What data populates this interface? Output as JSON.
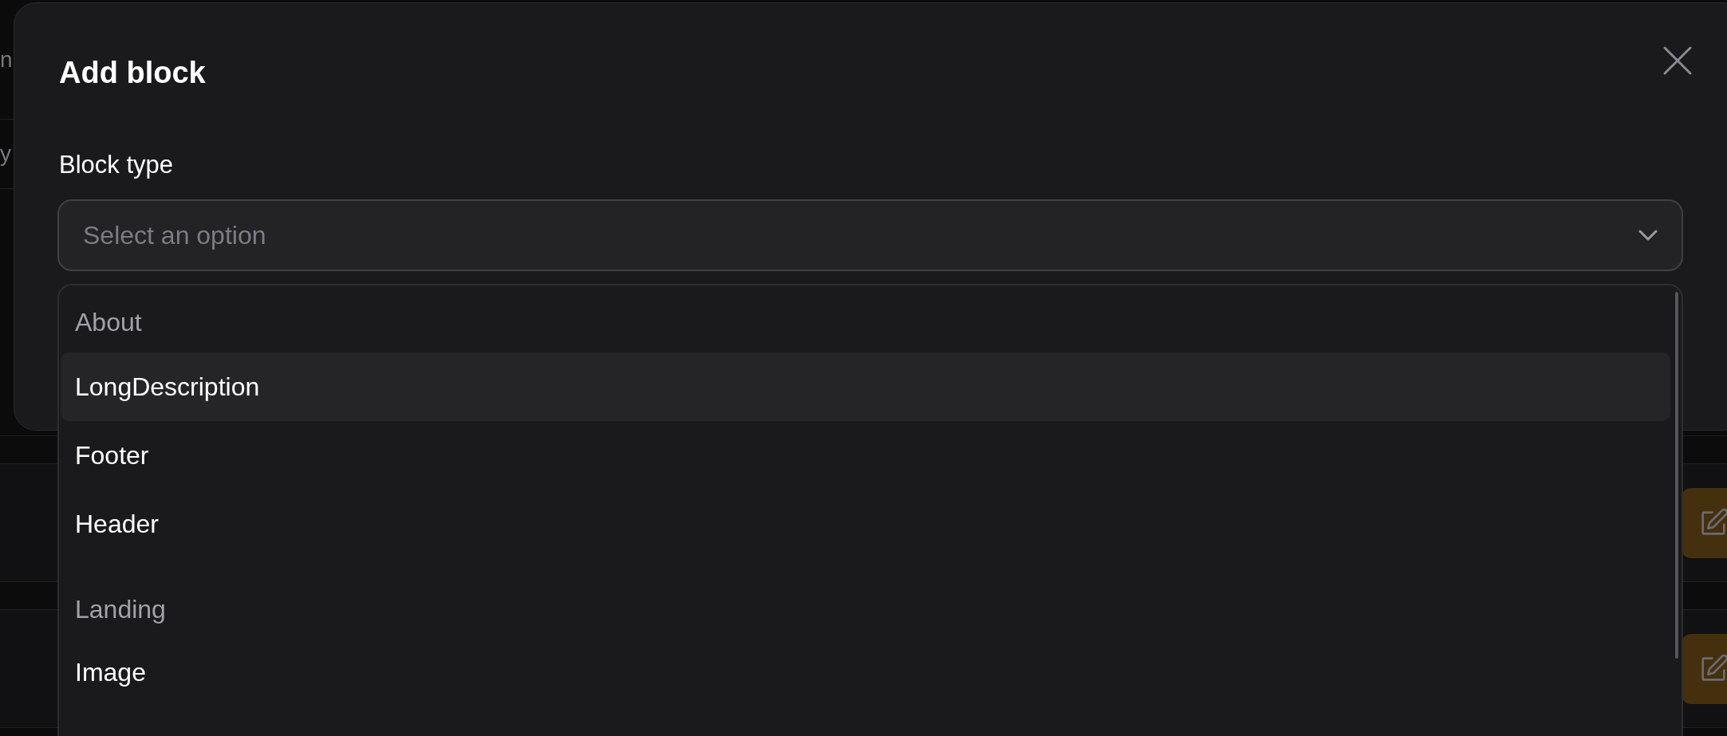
{
  "background": {
    "rows": [
      {
        "kind": "text",
        "cell": "n"
      },
      {
        "kind": "text",
        "cell": "y"
      },
      {
        "kind": "blank"
      },
      {
        "kind": "spacer"
      },
      {
        "kind": "action"
      },
      {
        "kind": "spacer"
      },
      {
        "kind": "action"
      }
    ]
  },
  "dialog": {
    "title": "Add block",
    "field_label": "Block type",
    "select": {
      "placeholder": "Select an option"
    },
    "options": [
      {
        "kind": "group",
        "label": "About"
      },
      {
        "kind": "option",
        "label": "LongDescription",
        "selected": true
      },
      {
        "kind": "option",
        "label": "Footer",
        "selected": false
      },
      {
        "kind": "option",
        "label": "Header",
        "selected": false
      },
      {
        "kind": "group",
        "label": "Landing"
      },
      {
        "kind": "option",
        "label": "Image",
        "selected": false
      }
    ]
  }
}
